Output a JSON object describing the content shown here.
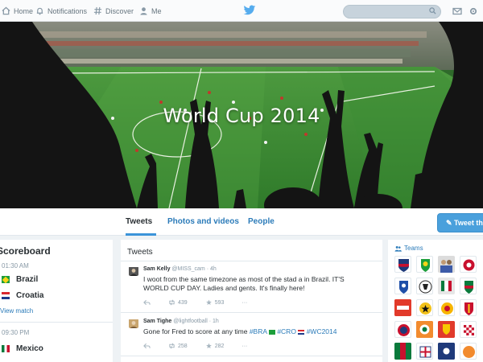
{
  "nav": {
    "items": [
      {
        "label": "Home",
        "icon": "home-icon"
      },
      {
        "label": "Notifications",
        "icon": "bell-icon"
      },
      {
        "label": "Discover",
        "icon": "hash-icon"
      },
      {
        "label": "Me",
        "icon": "person-icon"
      }
    ],
    "logo": "twitter-bird-icon",
    "search_placeholder": "",
    "right_icons": [
      "messages-icon",
      "settings-icon"
    ]
  },
  "hero": {
    "title": "World Cup 2014"
  },
  "tabs": [
    {
      "label": "Tweets",
      "active": true
    },
    {
      "label": "Photos and videos",
      "active": false
    },
    {
      "label": "People",
      "active": false
    }
  ],
  "follow_button": "Tweet this",
  "scoreboard": {
    "title": "Scoreboard",
    "matches": [
      {
        "time": "01:30 AM",
        "team1": "Brazil",
        "team2": "Croatia",
        "link": "View match"
      },
      {
        "time": "09:30 PM",
        "team1": "Mexico"
      }
    ]
  },
  "tweets": {
    "header": "Tweets",
    "items": [
      {
        "name": "Sam Kelly",
        "handle": "@MISS_cam",
        "time": "· 4h",
        "text": "I woot from the same timezone as most of the stad a in Brazil. IT'S WORLD CUP DAY. Ladies and gents. It's finally here!",
        "retweets": "439",
        "favorites": "593",
        "more": "···"
      },
      {
        "name": "Sam Tighe",
        "handle": "@lightfootball · 1h",
        "text_prefix": "Gone for Fred to score at any time ",
        "hashtags": [
          "#BRA",
          "#CRO",
          "#WC2014"
        ],
        "retweets": "258",
        "favorites": "282",
        "more": "···"
      }
    ]
  },
  "teams": {
    "header": "Teams"
  },
  "colors": {
    "accent": "#2b7bb9",
    "tab_underline": "#3b94d9",
    "pitch": "#3f8a36"
  }
}
